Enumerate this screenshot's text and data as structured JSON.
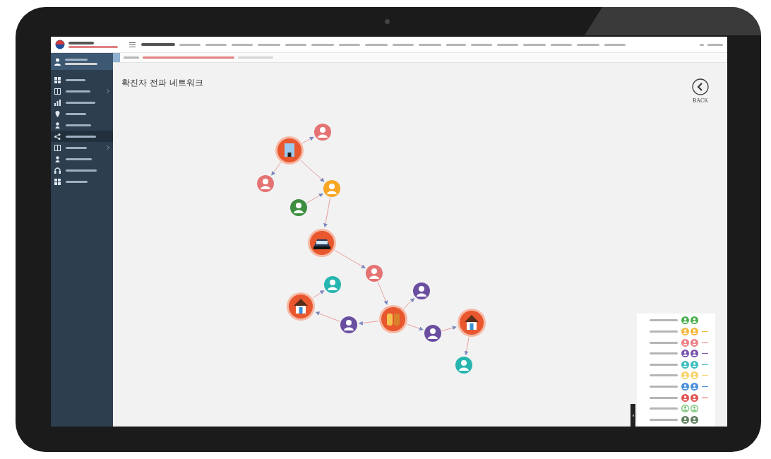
{
  "page": {
    "title": "확진자 전파 네트워크",
    "back_button": {
      "label": "BACK"
    }
  },
  "sidebar": {
    "items": [
      {
        "selected": false,
        "submenu": false
      },
      {
        "selected": false,
        "submenu": true
      },
      {
        "selected": false,
        "submenu": false
      },
      {
        "selected": false,
        "submenu": false
      },
      {
        "selected": false,
        "submenu": false
      },
      {
        "selected": true,
        "submenu": false
      },
      {
        "selected": false,
        "submenu": true
      },
      {
        "selected": false,
        "submenu": false
      },
      {
        "selected": false,
        "submenu": false
      },
      {
        "selected": false,
        "submenu": false
      }
    ]
  },
  "network": {
    "nodes": [
      {
        "kind": "building",
        "color": "#e8572e"
      },
      {
        "kind": "person",
        "color": "#e57373"
      },
      {
        "kind": "person",
        "color": "#e57373"
      },
      {
        "kind": "person",
        "color": "#f5a623"
      },
      {
        "kind": "person",
        "color": "#3e8e41"
      },
      {
        "kind": "car",
        "color": "#e8572e"
      },
      {
        "kind": "person",
        "color": "#e57373"
      },
      {
        "kind": "person",
        "color": "#26b5b0"
      },
      {
        "kind": "house",
        "color": "#e8572e"
      },
      {
        "kind": "person",
        "color": "#6a4ea0"
      },
      {
        "kind": "family",
        "color": "#e8572e"
      },
      {
        "kind": "person",
        "color": "#6a4ea0"
      },
      {
        "kind": "person",
        "color": "#6a4ea0"
      },
      {
        "kind": "house",
        "color": "#e8572e"
      },
      {
        "kind": "person",
        "color": "#26b5b0"
      }
    ]
  },
  "legend": {
    "rows": [
      {
        "kind": "filled",
        "color": "#4caf50",
        "tail": false
      },
      {
        "kind": "filled",
        "color": "#f5b942",
        "tail": true
      },
      {
        "kind": "filled",
        "color": "#ec7f86",
        "tail": true
      },
      {
        "kind": "filled",
        "color": "#7a55b0",
        "tail": true
      },
      {
        "kind": "filled",
        "color": "#3cbfc0",
        "tail": true
      },
      {
        "kind": "filled",
        "color": "#f7d36b",
        "tail": true
      },
      {
        "kind": "filled",
        "color": "#4a90d9",
        "tail": true
      },
      {
        "kind": "filled",
        "color": "#e0524f",
        "tail": true
      },
      {
        "kind": "outline",
        "color": "#7cc47c",
        "tail": false
      },
      {
        "kind": "filled",
        "color": "#5e7d5e",
        "tail": false
      }
    ]
  }
}
